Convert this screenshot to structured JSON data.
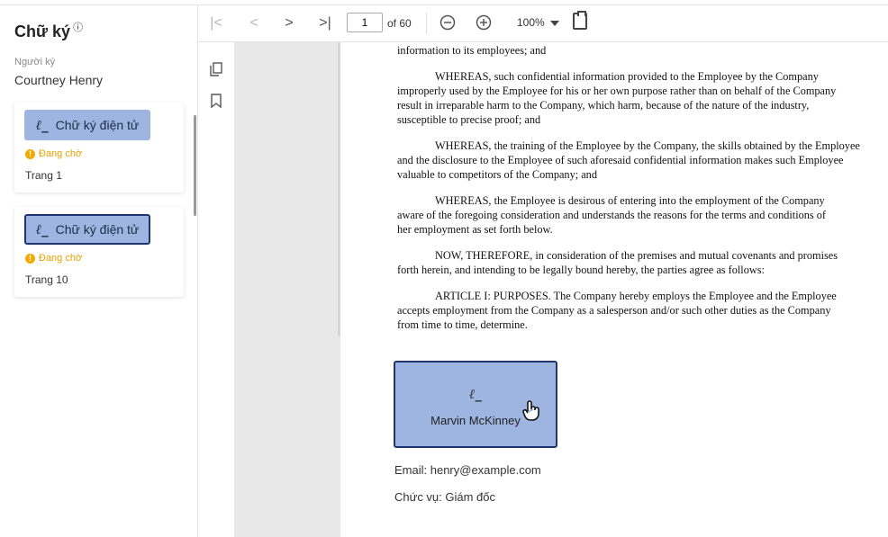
{
  "panel": {
    "title": "Chữ ký",
    "info_icon": "ⓘ",
    "signer_label": "Người ký",
    "signer_name": "Courtney Henry",
    "cards": [
      {
        "button_label": "Chữ ký điện tử",
        "status": "Đang chờ",
        "page": "Trang 1"
      },
      {
        "button_label": "Chữ ký điện tử",
        "status": "Đang chờ",
        "page": "Trang 10"
      }
    ]
  },
  "toolbar": {
    "page_value": "1",
    "of_text": "of 60",
    "zoom": "100%"
  },
  "document": {
    "paragraphs": [
      "information to its employees; and",
      "WHEREAS, such confidential information provided to the Employee by the Company",
      "improperly used by the Employee for his or her own purpose rather than on behalf of the Company",
      "result in irreparable harm to the Company, which harm, because of the nature of the industry,",
      "susceptible to precise proof; and",
      "WHEREAS, the training of the Employee by the Company, the skills obtained by the Employee",
      "and the disclosure to the Employee of such aforesaid confidential information makes such Employee",
      "valuable to competitors of the Company; and",
      "WHEREAS, the Employee is desirous of entering into the employment of the Company",
      "aware of the foregoing consideration and understands the reasons for the terms and conditions of",
      "her employment as set forth below.",
      "NOW, THEREFORE, in consideration of the premises and mutual covenants and promises",
      "forth herein, and intending to be legally bound hereby, the parties agree as follows:",
      "ARTICLE I: PURPOSES. The Company hereby employs the Employee and the Employee",
      "accepts employment from the Company as a salesperson and/or such other duties as the Company",
      "from time to time, determine."
    ],
    "signature_name": "Marvin McKinney",
    "email": "Email: henry@example.com",
    "role": "Chức vụ: Giám đốc"
  },
  "colors": {
    "signature_fill": "#9db5e0",
    "signature_border": "#1f3570",
    "pending": "#e6a100"
  }
}
